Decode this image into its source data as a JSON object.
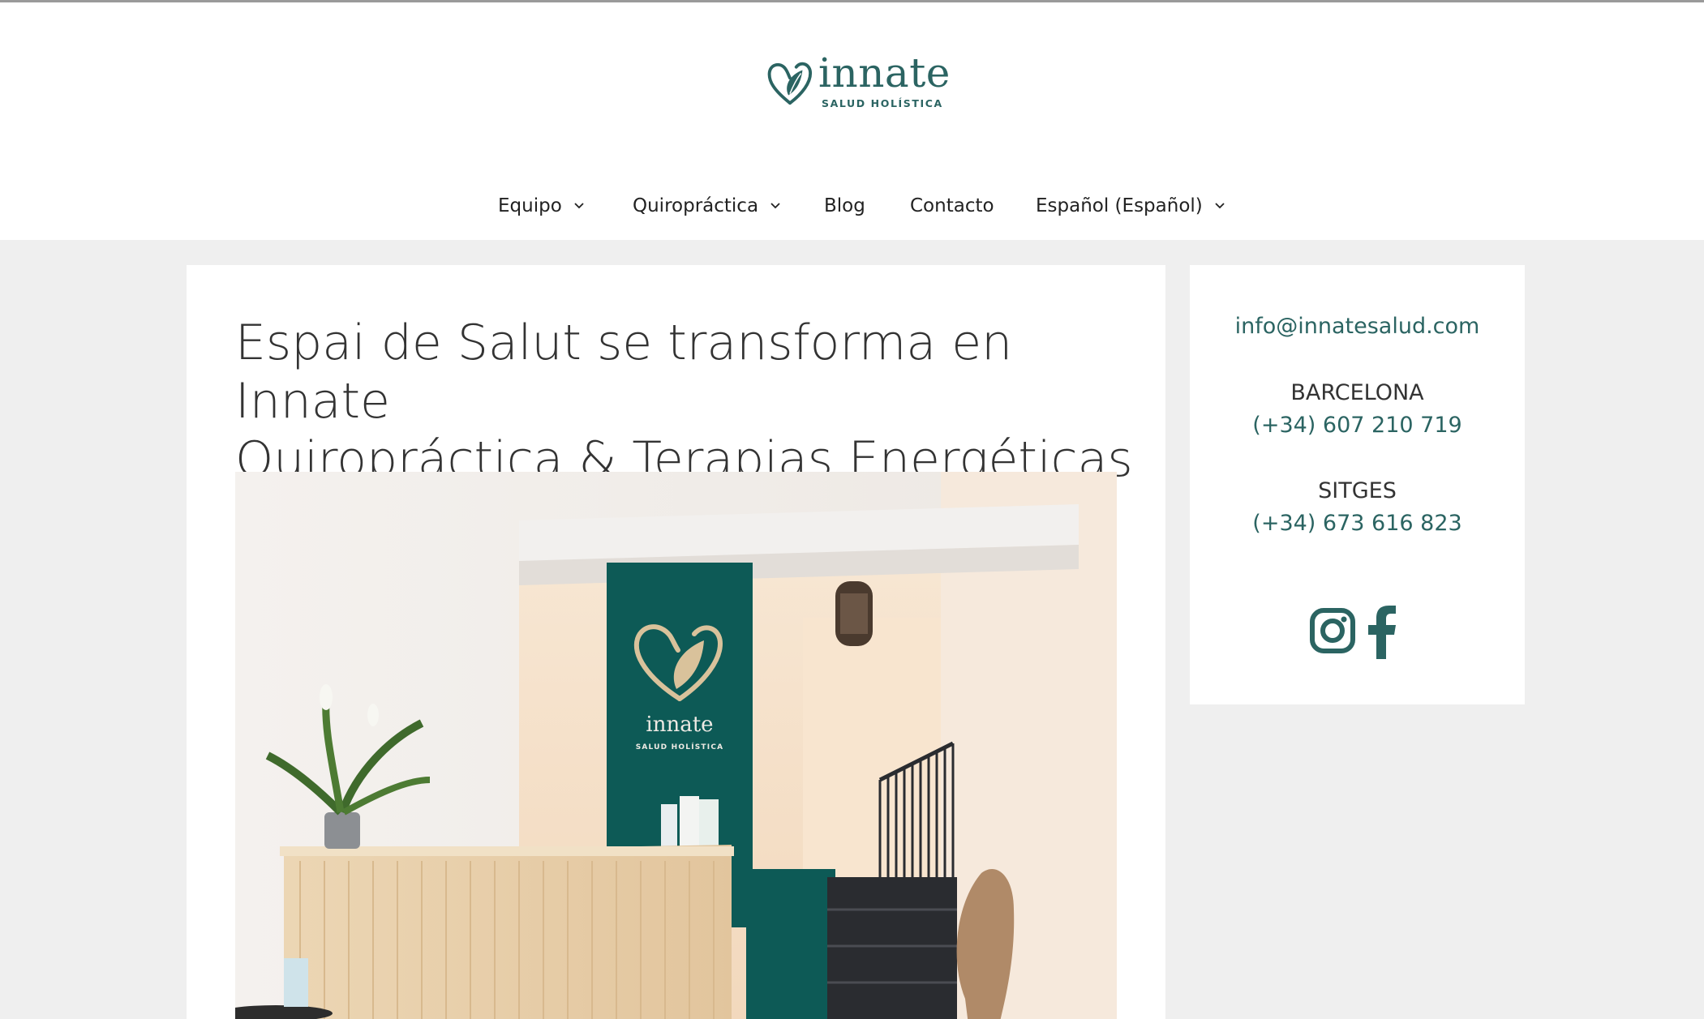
{
  "brand": {
    "name": "innate",
    "tagline": "SALUD HOLÍSTICA",
    "accent": "#2b6462"
  },
  "nav": {
    "items": [
      {
        "label": "Equipo",
        "has_dropdown": true
      },
      {
        "label": "Quiropráctica",
        "has_dropdown": true
      },
      {
        "label": "Blog",
        "has_dropdown": false
      },
      {
        "label": "Contacto",
        "has_dropdown": false
      },
      {
        "label": "Español (Español)",
        "has_dropdown": true
      }
    ]
  },
  "post": {
    "title_line1": "Espai de Salut se transforma en Innate",
    "title_line2": "Quiropráctica & Terapias Energéticas",
    "image_sign_name": "innate",
    "image_sign_tagline": "SALUD HOLÍSTICA"
  },
  "sidebar": {
    "email": "info@innatesalud.com",
    "locations": [
      {
        "city": "BARCELONA",
        "phone": "(+34) 607 210 719"
      },
      {
        "city": "SITGES",
        "phone": "(+34) 673 616 823"
      }
    ],
    "social_icons": [
      "instagram-icon",
      "facebook-icon"
    ]
  }
}
